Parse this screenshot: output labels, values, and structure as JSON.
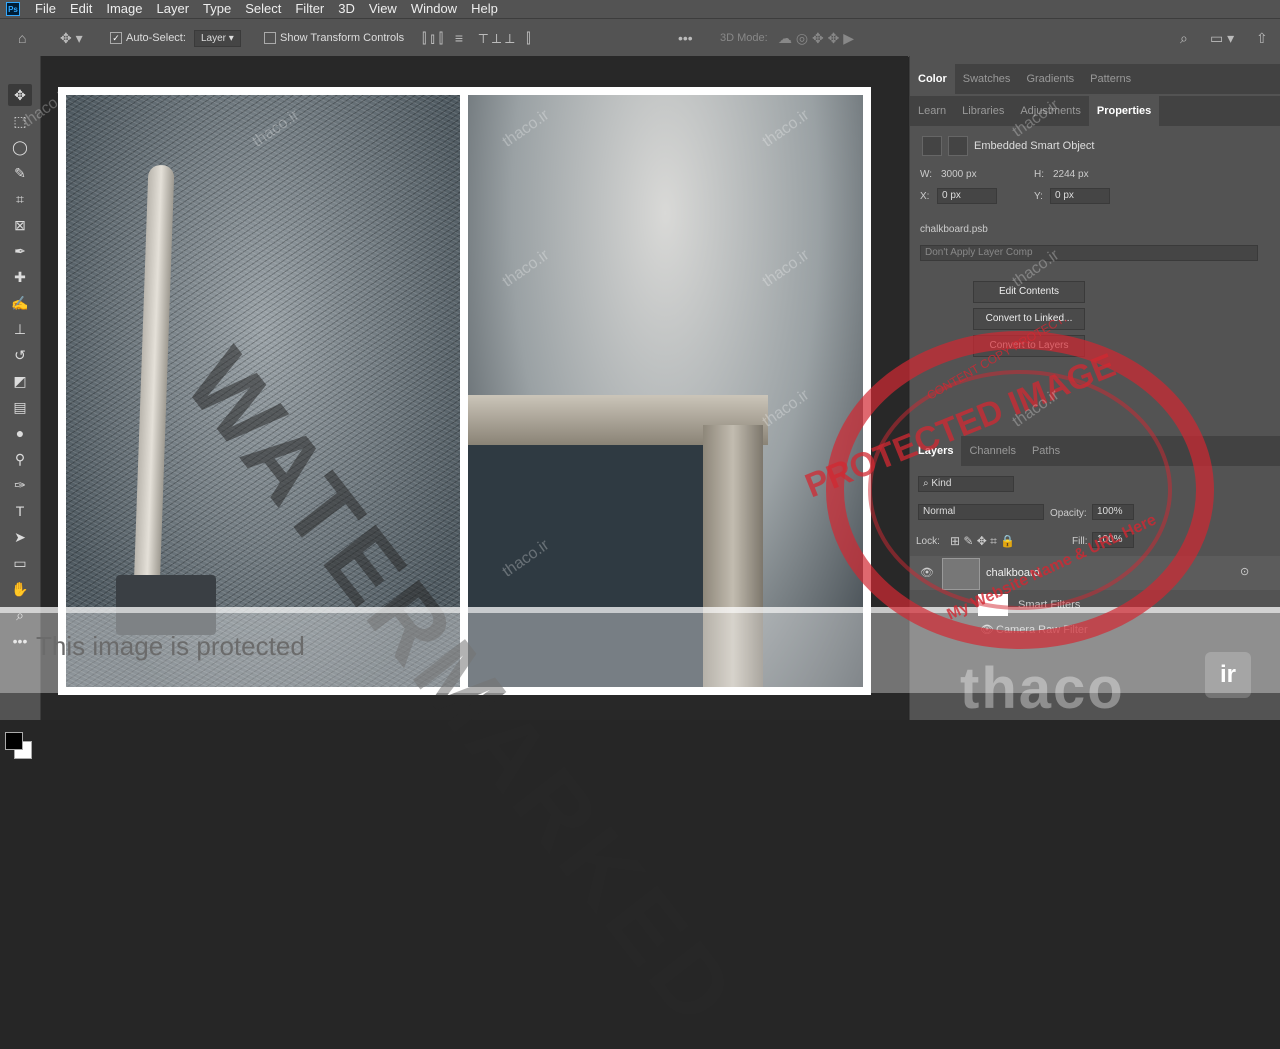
{
  "menu": [
    "File",
    "Edit",
    "Image",
    "Layer",
    "Type",
    "Select",
    "Filter",
    "3D",
    "View",
    "Window",
    "Help"
  ],
  "options": {
    "auto_select_label": "Auto-Select:",
    "auto_select_value": "Layer",
    "transform_label": "Show Transform Controls",
    "mode_3d": "3D Mode:"
  },
  "panel_top": {
    "tabs_row1": [
      "Color",
      "Swatches",
      "Gradients",
      "Patterns"
    ],
    "tabs_row2": [
      "Learn",
      "Libraries",
      "Adjustments",
      "Properties"
    ]
  },
  "properties": {
    "object_type": "Embedded Smart Object",
    "w_label": "W:",
    "w_value": "3000 px",
    "h_label": "H:",
    "h_value": "2244 px",
    "x_label": "X:",
    "x_value": "0 px",
    "y_label": "Y:",
    "y_value": "0 px",
    "filename": "chalkboard.psb",
    "layer_comp": "Don't Apply Layer Comp",
    "btn_edit": "Edit Contents",
    "btn_linked": "Convert to Linked...",
    "btn_layers": "Convert to Layers"
  },
  "layers_panel": {
    "tabs": [
      "Layers",
      "Channels",
      "Paths"
    ],
    "filter": "Kind",
    "blend": "Normal",
    "opacity_label": "Opacity:",
    "opacity": "100%",
    "lock_label": "Lock:",
    "fill_label": "Fill:",
    "fill": "100%",
    "layer_name": "chalkboard",
    "smart_filters": "Smart Filters",
    "filter_name": "Camera Raw Filter"
  },
  "overlays": {
    "protected_text": "This image is protected",
    "diagonal": "WATERMARKED",
    "stamp": "PROTECTED IMAGE",
    "stamp_small": "My Website Name & URL Here",
    "stamp_small2": "CONTENT COPY PROTECTION PLUGIN",
    "brand": "thaco",
    "brand_ir": "ir",
    "small_mark": "thaco.ir"
  }
}
